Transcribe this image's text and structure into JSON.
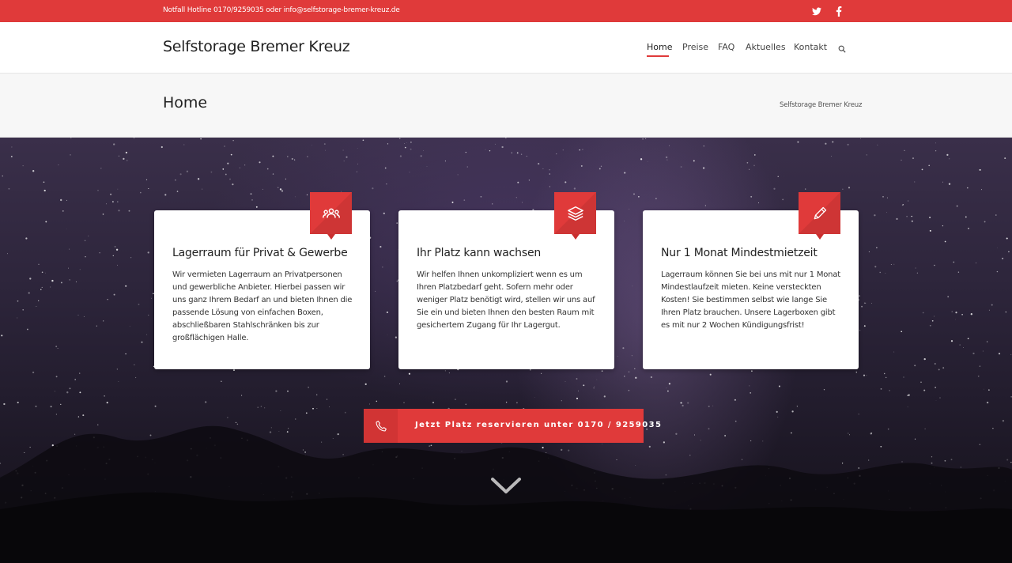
{
  "topbar": {
    "hotline": "Notfall Hotline 0170/9259035 oder info@selfstorage-bremer-kreuz.de",
    "social": [
      "twitter-icon",
      "facebook-icon"
    ],
    "color": "#e03a3a"
  },
  "header": {
    "logo": "Selfstorage Bremer Kreuz",
    "nav": [
      "Home",
      "Preise",
      "FAQ",
      "Aktuelles",
      "Kontakt"
    ],
    "active": "Home",
    "search_icon": "search-icon"
  },
  "titlebar": {
    "title": "Home",
    "breadcrumb": "Selfstorage Bremer Kreuz"
  },
  "features": [
    {
      "icon": "users-icon",
      "title": "Lagerraum für Privat & Gewerbe",
      "text": "Wir vermieten Lagerraum an Privatpersonen und gewerbliche Anbieter. Hierbei passen wir uns ganz Ihrem Bedarf an und bieten Ihnen die passende Lösung von einfachen Boxen, abschließbaren Stahlschränken bis zur großflächigen Halle."
    },
    {
      "icon": "layers-icon",
      "title": "Ihr Platz kann wachsen",
      "text": "Wir helfen Ihnen unkompliziert wenn es um Ihren Platzbedarf geht. Sofern mehr oder weniger Platz benötigt wird, stellen wir uns auf Sie ein und bieten Ihnen den besten Raum mit gesichertem Zugang für Ihr Lagergut."
    },
    {
      "icon": "pencil-icon",
      "title": "Nur 1 Monat Mindestmietzeit",
      "text": "Lagerraum können Sie bei uns mit nur 1 Monat Mindestlaufzeit mieten. Keine versteckten Kosten! Sie bestimmen selbst wie lange Sie Ihren Platz brauchen. Unsere Lagerboxen gibt es mit nur 2 Wochen Kündigungsfrist!"
    }
  ],
  "cta": {
    "icon": "phone-icon",
    "label": "Jetzt Platz reservieren unter 0170 / 9259035"
  },
  "scroll_icon": "chevron-down-icon"
}
